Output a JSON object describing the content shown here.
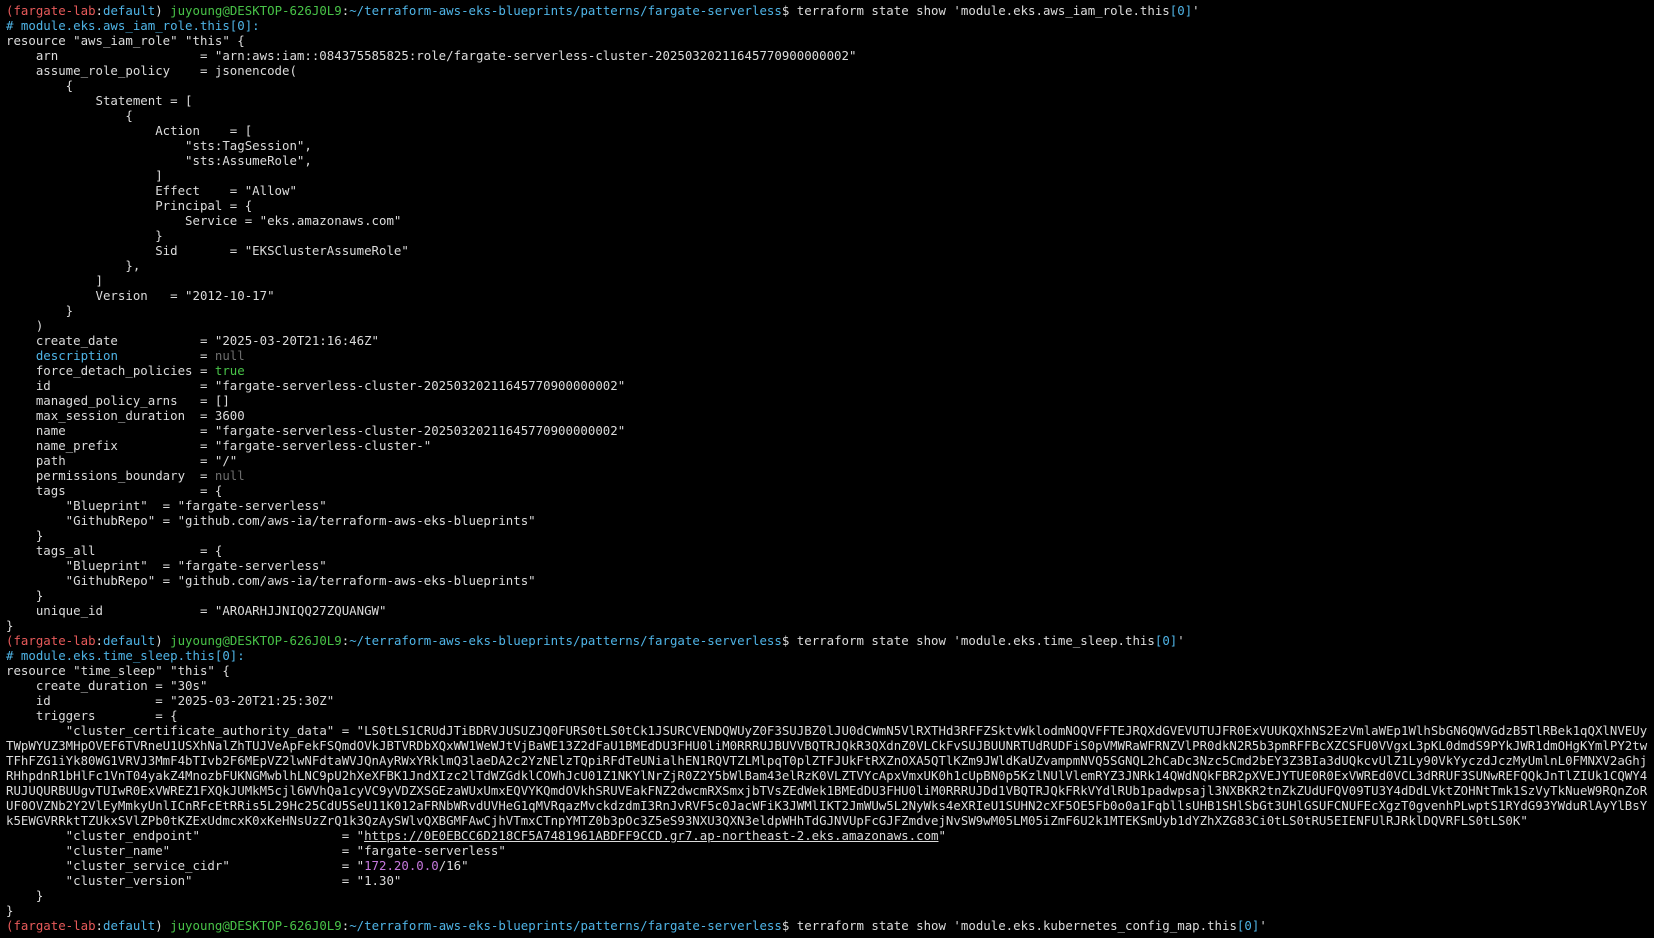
{
  "window": {
    "title": "juyoung@DESKTOP-626J0L9: ~/terraform-aws-eks-blueprints/patterns/fargate-serverless"
  },
  "colors": {
    "background": "#000000",
    "text": "#dcdcdc",
    "prompt_env": "#e75a5a",
    "prompt_branch": "#4fb4e6",
    "prompt_user": "#48c348",
    "prompt_path": "#4fb4e6",
    "comment": "#4fb4e6",
    "null": "#6e6e6e",
    "bool": "#48c348",
    "magenta": "#c678dd"
  },
  "terminal": {
    "lines": [
      [
        [
          "prompt-env",
          "("
        ],
        [
          "prompt-env",
          "fargate-lab"
        ],
        [
          "text",
          ":"
        ],
        [
          "prompt-branch",
          "default"
        ],
        [
          "text",
          ") "
        ],
        [
          "prompt-user",
          "juyoung@DESKTOP-626J0L9"
        ],
        [
          "text",
          ":"
        ],
        [
          "prompt-path",
          "~/terraform-aws-eks-blueprints/patterns/fargate-serverless"
        ],
        [
          "text",
          "$ terraform state show 'module.eks.aws_iam_role.this"
        ],
        [
          "prompt-branch",
          "[0]"
        ],
        [
          "text",
          "'"
        ]
      ],
      [
        [
          "comment",
          "# module.eks.aws_iam_role.this[0]:"
        ]
      ],
      [
        [
          "text",
          "resource \"aws_iam_role\" \"this\" {"
        ]
      ],
      [
        [
          "text",
          "    arn                   = \"arn:aws:iam::084375585825:role/fargate-serverless-cluster-20250320211645770900000002\""
        ]
      ],
      [
        [
          "text",
          "    assume_role_policy    = jsonencode("
        ]
      ],
      [
        [
          "text",
          "        {"
        ]
      ],
      [
        [
          "text",
          "            Statement = ["
        ]
      ],
      [
        [
          "text",
          "                {"
        ]
      ],
      [
        [
          "text",
          "                    Action    = ["
        ]
      ],
      [
        [
          "text",
          "                        \"sts:TagSession\","
        ]
      ],
      [
        [
          "text",
          "                        \"sts:AssumeRole\","
        ]
      ],
      [
        [
          "text",
          "                    ]"
        ]
      ],
      [
        [
          "text",
          "                    Effect    = \"Allow\""
        ]
      ],
      [
        [
          "text",
          "                    Principal = {"
        ]
      ],
      [
        [
          "text",
          "                        Service = \"eks.amazonaws.com\""
        ]
      ],
      [
        [
          "text",
          "                    }"
        ]
      ],
      [
        [
          "text",
          "                    Sid       = \"EKSClusterAssumeRole\""
        ]
      ],
      [
        [
          "text",
          "                },"
        ]
      ],
      [
        [
          "text",
          "            ]"
        ]
      ],
      [
        [
          "text",
          "            Version   = \"2012-10-17\""
        ]
      ],
      [
        [
          "text",
          "        }"
        ]
      ],
      [
        [
          "text",
          "    )"
        ]
      ],
      [
        [
          "text",
          "    create_date           = \"2025-03-20T21:16:46Z\""
        ]
      ],
      [
        [
          "text",
          "    "
        ],
        [
          "keyword",
          "description"
        ],
        [
          "text",
          "           = "
        ],
        [
          "null",
          "null"
        ]
      ],
      [
        [
          "text",
          "    force_detach_policies = "
        ],
        [
          "bool",
          "true"
        ]
      ],
      [
        [
          "text",
          "    id                    = \"fargate-serverless-cluster-20250320211645770900000002\""
        ]
      ],
      [
        [
          "text",
          "    managed_policy_arns   = []"
        ]
      ],
      [
        [
          "text",
          "    max_session_duration  = 3600"
        ]
      ],
      [
        [
          "text",
          "    name                  = \"fargate-serverless-cluster-20250320211645770900000002\""
        ]
      ],
      [
        [
          "text",
          "    name_prefix           = \"fargate-serverless-cluster-\""
        ]
      ],
      [
        [
          "text",
          "    path                  = \"/\""
        ]
      ],
      [
        [
          "text",
          "    permissions_boundary  = "
        ],
        [
          "null",
          "null"
        ]
      ],
      [
        [
          "text",
          "    tags                  = {"
        ]
      ],
      [
        [
          "text",
          "        \"Blueprint\"  = \"fargate-serverless\""
        ]
      ],
      [
        [
          "text",
          "        \"GithubRepo\" = \"github.com/aws-ia/terraform-aws-eks-blueprints\""
        ]
      ],
      [
        [
          "text",
          "    }"
        ]
      ],
      [
        [
          "text",
          "    tags_all              = {"
        ]
      ],
      [
        [
          "text",
          "        \"Blueprint\"  = \"fargate-serverless\""
        ]
      ],
      [
        [
          "text",
          "        \"GithubRepo\" = \"github.com/aws-ia/terraform-aws-eks-blueprints\""
        ]
      ],
      [
        [
          "text",
          "    }"
        ]
      ],
      [
        [
          "text",
          "    unique_id             = \"AROARHJJNIQQ27ZQUANGW\""
        ]
      ],
      [
        [
          "text",
          "}"
        ]
      ],
      [
        [
          "prompt-env",
          "("
        ],
        [
          "prompt-env",
          "fargate-lab"
        ],
        [
          "text",
          ":"
        ],
        [
          "prompt-branch",
          "default"
        ],
        [
          "text",
          ") "
        ],
        [
          "prompt-user",
          "juyoung@DESKTOP-626J0L9"
        ],
        [
          "text",
          ":"
        ],
        [
          "prompt-path",
          "~/terraform-aws-eks-blueprints/patterns/fargate-serverless"
        ],
        [
          "text",
          "$ terraform state show 'module.eks.time_sleep.this"
        ],
        [
          "prompt-branch",
          "[0]"
        ],
        [
          "text",
          "'"
        ]
      ],
      [
        [
          "comment",
          "# module.eks.time_sleep.this[0]:"
        ]
      ],
      [
        [
          "text",
          "resource \"time_sleep\" \"this\" {"
        ]
      ],
      [
        [
          "text",
          "    create_duration = \"30s\""
        ]
      ],
      [
        [
          "text",
          "    id              = \"2025-03-20T21:25:30Z\""
        ]
      ],
      [
        [
          "text",
          "    triggers        = {"
        ]
      ],
      [
        [
          "wrap",
          "        \"cluster_certificate_authority_data\" = \"LS0tLS1CRUdJTiBDRVJUSUZJQ0FURS0tLS0tCk1JSURCVENDQWUyZ0F3SUJBZ0lJU0dCWmN5VlRXTHd3RFFZSktvWklodmNOQVFFTEJRQXdGVEVUTUJFR0ExVUUKQXhNS2EzVmlaWEp1WlhSbGN6QWVGdzB5TlRBek1qQXlNVEUyTWpWYUZ3MHpOVEF6TVRneU1USXhNalZhTUJVeApFekFSQmdOVkJBTVRDbXQxWW1WeWJtVjBaWE13Z2dFaU1BMEdDU3FHU0liM0RRRUJBUVVBQTRJQkR3QXdnZ0VLCkFvSUJBUUNRTUdRUDFiS0pVMWRaWFRNZVlPR0dkN2R5b3pmRFFBcXZCSFU0VVgxL3pKL0dmdS9PYkJWR1dmOHgKYmlPY2twTFhFZG1iYk80WG1VRVJ3MmF4bTIvb2F6MEpVZ2lwNFdtaWVJQnAyRWxYRklmQ3laeDA2c2YzNElzTQpiRFdTeUNialhEN1RQVTZLMlpqT0plZTFJUkFtRXZnOXA5QTlKZm9JWldKaUZvampmNVQ5SGNQL2hCaDc3Nzc5Cmd2bEY3Z3BIa3dUQkcvUlZ1Ly90VkYyczdJczMyUmlnL0FMNXV2aGhjRHhpdnR1bHlFc1VnT04yakZ4MnozbFUKNGMwblhLNC9pU2hXeXFBK1JndXIzc2lTdWZGdklCOWhJcU01Z1NKYlNrZjR0Z2Y5bWlBam43elRzK0VLZTVYcApxVmxUK0h1cUpBN0p5KzlNUlVlemRYZ3JNRk14QWdNQkFBR2pXVEJYTUE0R0ExVWREd0VCL3dRRUF3SUNwREFQQkJnTlZIUk1CQWY4RUJUQURBUUgvTUIwR0ExVWREZ1FXQkJUMkM5cjl6WVhQa1cyVC9yVDZXSGEzaWUxUmxEQVYKQmdOVkhSRUVEakFNZ2dwcmRXSmxjbTVsZEdWek1BMEdDU3FHU0liM0RRRUJDd1VBQTRJQkFRkVYdlRUb1padwpsajl3NXBKR2tnZkZUdUFQV09TU3Y4dDdLVktZOHNtTmk1SzVyTkNueW9RQnZoRUF0OVZNb2Y2VlEyMmkyUnlICnRFcEtRRis5L29Hc25CdU5SeU11K012aFRNbWRvdUVHeG1qMVRqazMvckdzdmI3RnJvRVF5c0JacWFiK3JWMlIKT2JmWUw5L2NyWks4eXRIeU1SUHN2cXF5OE5Fb0o0a1FqbllsUHB1SHlSbGt3UHlGSUFCNUFEcXgzT0gvenhPLwptS1RYdG93YWduRlAyYlBsYk5EWGVRRktTZUkxSVlZPb0tKZExUdmcxK0xKeHNsUzZrQ1k3QzAySWlvQXBGMFAwCjhVTmxCTnpYMTZ0b3pOc3Z5eS93NXU3QXN3eldpWHhTdGJNVUpFcGJFZmdvejNvSW9wM05LM05iZmF6U2k1MTEKSmUyb1dYZhXZG83Ci0tLS0tRU5EIENFUlRJRklDQVRFLS0tLS0K\""
        ]
      ],
      [
        [
          "text",
          "        \"cluster_endpoint\"                   = \""
        ],
        [
          "link",
          "https://0E0EBCC6D218CF5A7481961ABDFF9CCD.gr7.ap-northeast-2.eks.amazonaws.com"
        ],
        [
          "text",
          "\""
        ]
      ],
      [
        [
          "text",
          "        \"cluster_name\"                       = \"fargate-serverless\""
        ]
      ],
      [
        [
          "text",
          "        \"cluster_service_cidr\"               = \""
        ],
        [
          "magenta",
          "172.20.0.0"
        ],
        [
          "text",
          "/16\""
        ]
      ],
      [
        [
          "text",
          "        \"cluster_version\"                    = \"1.30\""
        ]
      ],
      [
        [
          "text",
          "    }"
        ]
      ],
      [
        [
          "text",
          "}"
        ]
      ],
      [
        [
          "prompt-env",
          "("
        ],
        [
          "prompt-env",
          "fargate-lab"
        ],
        [
          "text",
          ":"
        ],
        [
          "prompt-branch",
          "default"
        ],
        [
          "text",
          ") "
        ],
        [
          "prompt-user",
          "juyoung@DESKTOP-626J0L9"
        ],
        [
          "text",
          ":"
        ],
        [
          "prompt-path",
          "~/terraform-aws-eks-blueprints/patterns/fargate-serverless"
        ],
        [
          "text",
          "$ terraform state show 'module.eks.kubernetes_config_map.this"
        ],
        [
          "prompt-branch",
          "[0]"
        ],
        [
          "text",
          "'"
        ]
      ]
    ]
  }
}
